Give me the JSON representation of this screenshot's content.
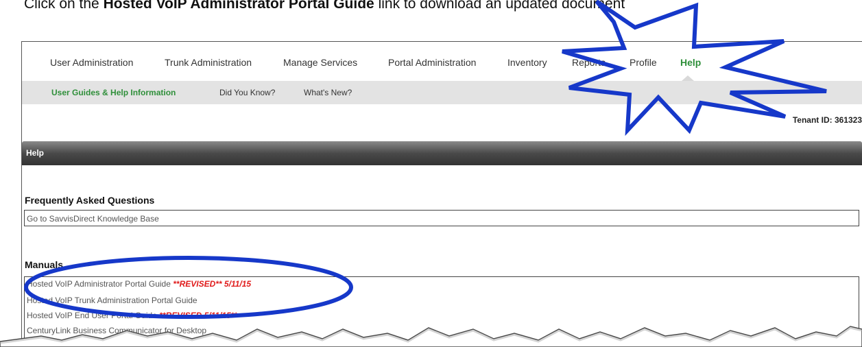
{
  "instruction": {
    "prefix": "Click on the ",
    "bold": "Hosted VoIP  Administrator Portal Guide",
    "suffix": " link to download an updated document"
  },
  "topnav": {
    "items": [
      {
        "label": "User Administration"
      },
      {
        "label": "Trunk Administration"
      },
      {
        "label": "Manage Services"
      },
      {
        "label": "Portal Administration"
      },
      {
        "label": "Inventory"
      },
      {
        "label": "Reports"
      },
      {
        "label": "Profile"
      },
      {
        "label": "Help"
      }
    ],
    "active": "Help"
  },
  "subnav": {
    "items": [
      {
        "label": "User Guides & Help Information"
      },
      {
        "label": "Did You Know?"
      },
      {
        "label": "What's New?"
      }
    ],
    "active": "User Guides & Help Information"
  },
  "tenant": "Tenant ID: 361323",
  "panel": {
    "title": "Help"
  },
  "faq": {
    "title": "Frequently Asked Questions",
    "link": "Go to SavvisDirect Knowledge Base"
  },
  "manuals": {
    "title": "Manuals",
    "items": [
      {
        "label": "Hosted VoIP Administrator Portal Guide ",
        "revised": "**REVISED** 5/11/15"
      },
      {
        "label": "Hosted VoIP Trunk Administration Portal Guide",
        "revised": ""
      },
      {
        "label": "Hosted VoIP End User Portal Guide ",
        "revised": "**REVISED 5/11/15**"
      },
      {
        "label": "CenturyLink Business Communicator for Desktop",
        "revised": ""
      }
    ]
  },
  "colors": {
    "accent_green": "#2f8f3a",
    "revised_red": "#e01b1b",
    "annotation_blue": "#1638c9"
  },
  "annotations": [
    "starburst-callout",
    "ellipse-highlight",
    "torn-edge"
  ]
}
